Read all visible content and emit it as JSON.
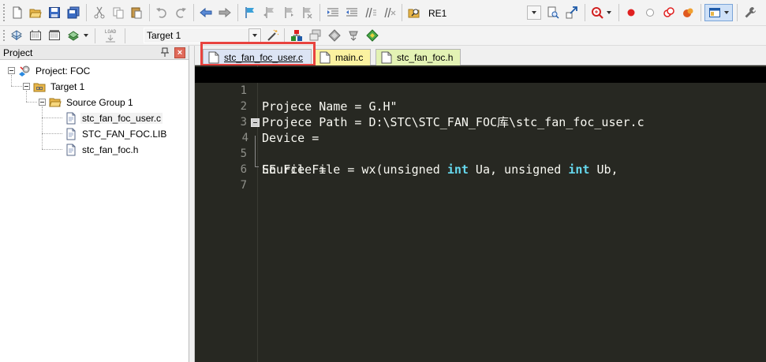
{
  "toolbar1": {
    "target_combo": {
      "value": "RE1"
    },
    "colors": {
      "red_dot": "#e02020",
      "accent_blue": "#1e5aa8"
    }
  },
  "toolbar2": {
    "target_select": {
      "value": "Target 1"
    },
    "load_label": "LOAD"
  },
  "project_panel": {
    "title": "Project",
    "close_symbol": "×",
    "tree": {
      "project": "Project: FOC",
      "target": "Target 1",
      "group": "Source Group 1",
      "files": [
        "stc_fan_foc_user.c",
        "STC_FAN_FOC.LIB",
        "stc_fan_foc.h"
      ]
    }
  },
  "tabs": [
    {
      "label": "stc_fan_foc_user.c",
      "active": true
    },
    {
      "label": "main.c",
      "active": false
    },
    {
      "label": "stc_fan_foc.h",
      "active": false
    }
  ],
  "editor": {
    "line_numbers": [
      "1",
      "2",
      "3",
      "4",
      "5",
      "6",
      "7"
    ],
    "lines": {
      "l1": "Projece Name = G.H\"",
      "l2": "Projece Path = D:\\STC\\STC_FAN_FOC库\\stc_fan_foc_user.c",
      "l3": "Device =",
      "l4a": "Source File = wx(unsigned ",
      "l4kw1": "int",
      "l4b": " Ua, unsigned ",
      "l4kw2": "int",
      "l4c": " Ub,",
      "l5": "EE File =",
      "l6": "",
      "l7": ""
    },
    "colors": {
      "background": "#272822",
      "keyword": "#66d9ef",
      "text": "#f8f8f2"
    }
  }
}
